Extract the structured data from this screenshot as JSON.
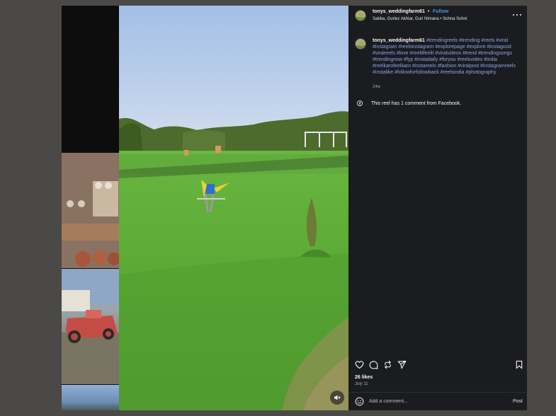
{
  "post": {
    "username": "tonys_weddingfarm61",
    "separator": "•",
    "follow_label": "Follow",
    "audio_info": "Sabba, Gurlez Akhtar, Guri Nimana • Sohna Sohni",
    "caption_username": "tonys_weddingfarm61",
    "caption_tags": "#trendingreels #trending #reels #viral #instagram #reelsinstagram #explorepage #explore #instagood #viralreels #love #reelitfeelit #viralvideos #trend #trendingsongs #trendingnow #fyp #instadaily #foryou #reelsvideo #india #reelkarofeelkaro #instareels #fashion #viralpost #instagramreels #instalike #followforfollowback #reelsindia #photography",
    "age": "24w",
    "facebook_note": "This reel has 1 comment from Facebook.",
    "likes": "26 likes",
    "date": "July 11"
  },
  "comment_box": {
    "placeholder": "Add a comment...",
    "post_label": "Post"
  },
  "icons": {
    "more": "more-options-icon",
    "facebook": "facebook-icon",
    "like": "heart-icon",
    "comment": "comment-icon",
    "share": "share-icon",
    "send": "send-icon",
    "save": "bookmark-icon",
    "emoji": "emoji-icon",
    "mute": "speaker-muted-icon"
  },
  "colors": {
    "panel_bg": "#1b1c1f",
    "page_bg": "#4a4947",
    "link_blue": "#4a90f2",
    "hashtag": "#8ea2ea"
  }
}
